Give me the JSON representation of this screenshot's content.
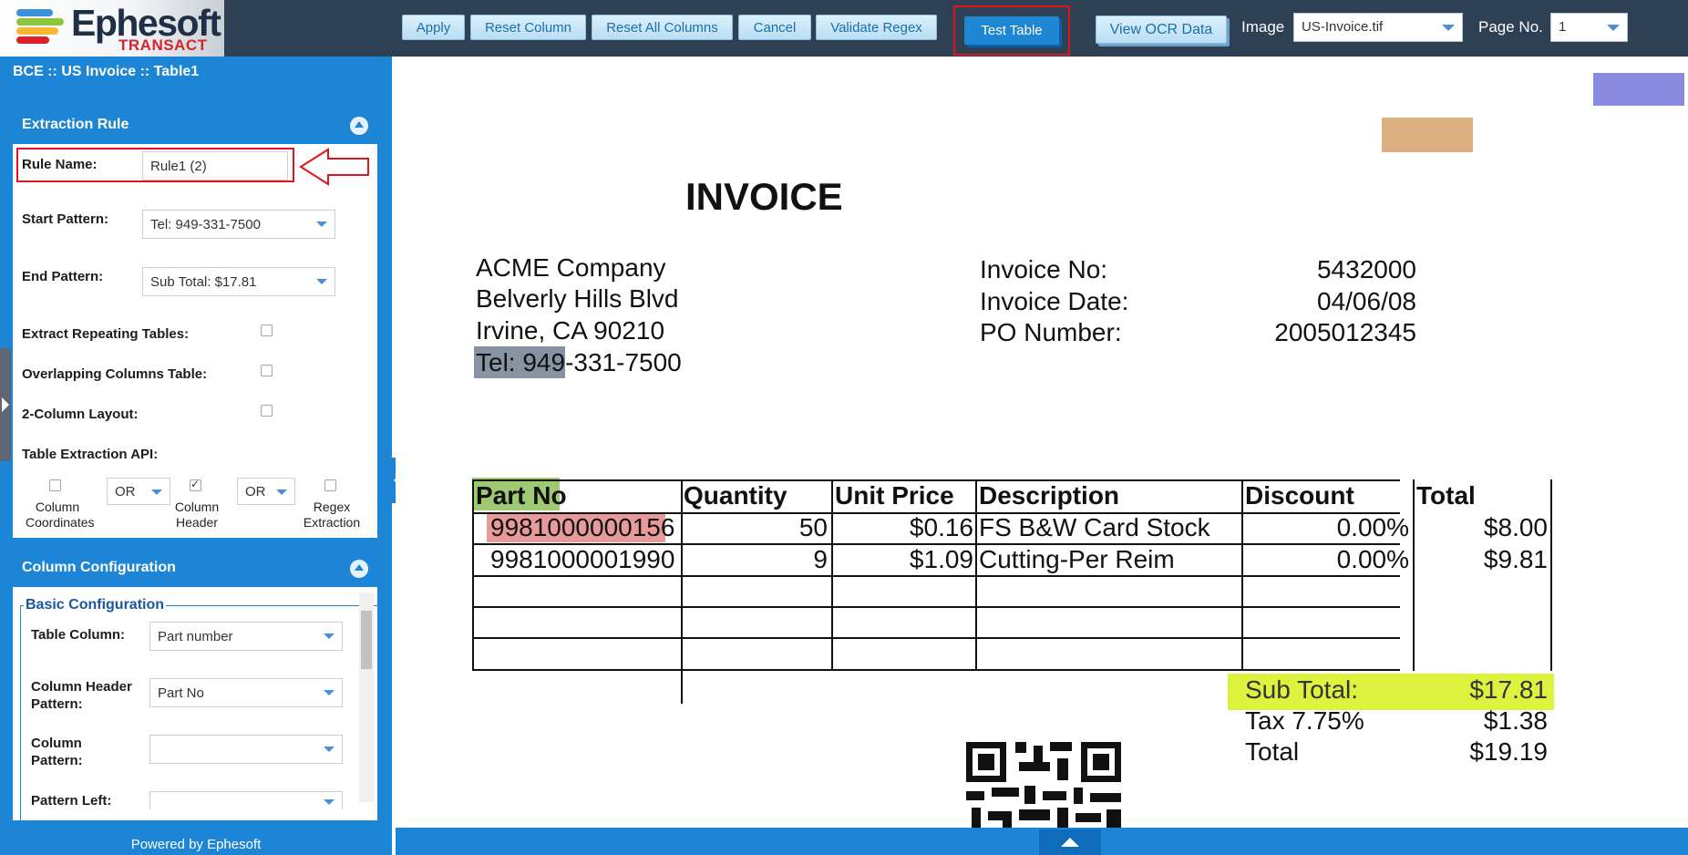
{
  "header": {
    "logo_title": "Ephesoft",
    "logo_subtitle": "TRANSACT",
    "buttons": {
      "apply": "Apply",
      "reset_column": "Reset Column",
      "reset_all_columns": "Reset All Columns",
      "cancel": "Cancel",
      "validate_regex": "Validate Regex",
      "test_table": "Test Table",
      "view_ocr_data": "View OCR Data"
    },
    "image_label": "Image",
    "image_value": "US-Invoice.tif",
    "page_label": "Page No.",
    "page_value": "1"
  },
  "left_panel": {
    "breadcrumb": "BCE :: US Invoice :: Table1",
    "extraction_rule": {
      "title": "Extraction Rule",
      "rule_name_label": "Rule Name:",
      "rule_name_value": "Rule1 (2)",
      "start_pattern_label": "Start Pattern:",
      "start_pattern_value": "Tel: 949-331-7500",
      "end_pattern_label": "End Pattern:",
      "end_pattern_value": "Sub Total: $17.81",
      "extract_repeating_label": "Extract Repeating Tables:",
      "overlapping_columns_label": "Overlapping Columns Table:",
      "two_column_label": "2-Column Layout:",
      "table_api_label": "Table Extraction API:",
      "api_column_coordinates": "Column Coordinates",
      "api_column_header": "Column Header",
      "api_regex_extraction": "Regex Extraction",
      "operator_1": "OR",
      "operator_2": "OR"
    },
    "column_configuration": {
      "title": "Column Configuration",
      "basic_configuration": "Basic Configuration",
      "table_column_label": "Table Column:",
      "table_column_value": "Part number",
      "column_header_pattern_label": "Column Header Pattern:",
      "column_header_pattern_value": "Part No",
      "column_pattern_label": "Column Pattern:",
      "column_pattern_value": "",
      "pattern_left_label": "Pattern Left:"
    },
    "footer": "Powered by Ephesoft"
  },
  "document": {
    "title": "INVOICE",
    "company": [
      "ACME Company",
      "Belverly Hills Blvd",
      "Irvine, CA 90210"
    ],
    "tel_highlight": "Tel: 949",
    "tel_rest": "-331-7500",
    "meta": [
      {
        "label": "Invoice No:",
        "value": "5432000"
      },
      {
        "label": "Invoice Date:",
        "value": "04/06/08"
      },
      {
        "label": "PO Number:",
        "value": "2005012345"
      }
    ],
    "table": {
      "headers": [
        "Part No",
        "Quantity",
        "Unit Price",
        "Description",
        "Discount",
        "Total"
      ],
      "rows": [
        [
          "9981000000156",
          "50",
          "$0.16",
          "FS B&W Card Stock",
          "0.00%",
          "$8.00"
        ],
        [
          "9981000001990",
          "9",
          "$1.09",
          "Cutting-Per Reim",
          "0.00%",
          "$9.81"
        ]
      ]
    },
    "totals": [
      {
        "label": "Sub Total:",
        "value": "$17.81"
      },
      {
        "label": "Tax 7.75%",
        "value": "$1.38"
      },
      {
        "label": "Total",
        "value": "$19.19"
      }
    ]
  },
  "colors": {
    "accent_blue": "#1c85d5",
    "header_dark": "#2e4054",
    "annotation_red": "#e0151b",
    "highlight_green": "#8fbf5a",
    "highlight_pink": "#e89a9a",
    "highlight_yellow": "#dcf23c",
    "highlight_gray": "#8793a2"
  }
}
